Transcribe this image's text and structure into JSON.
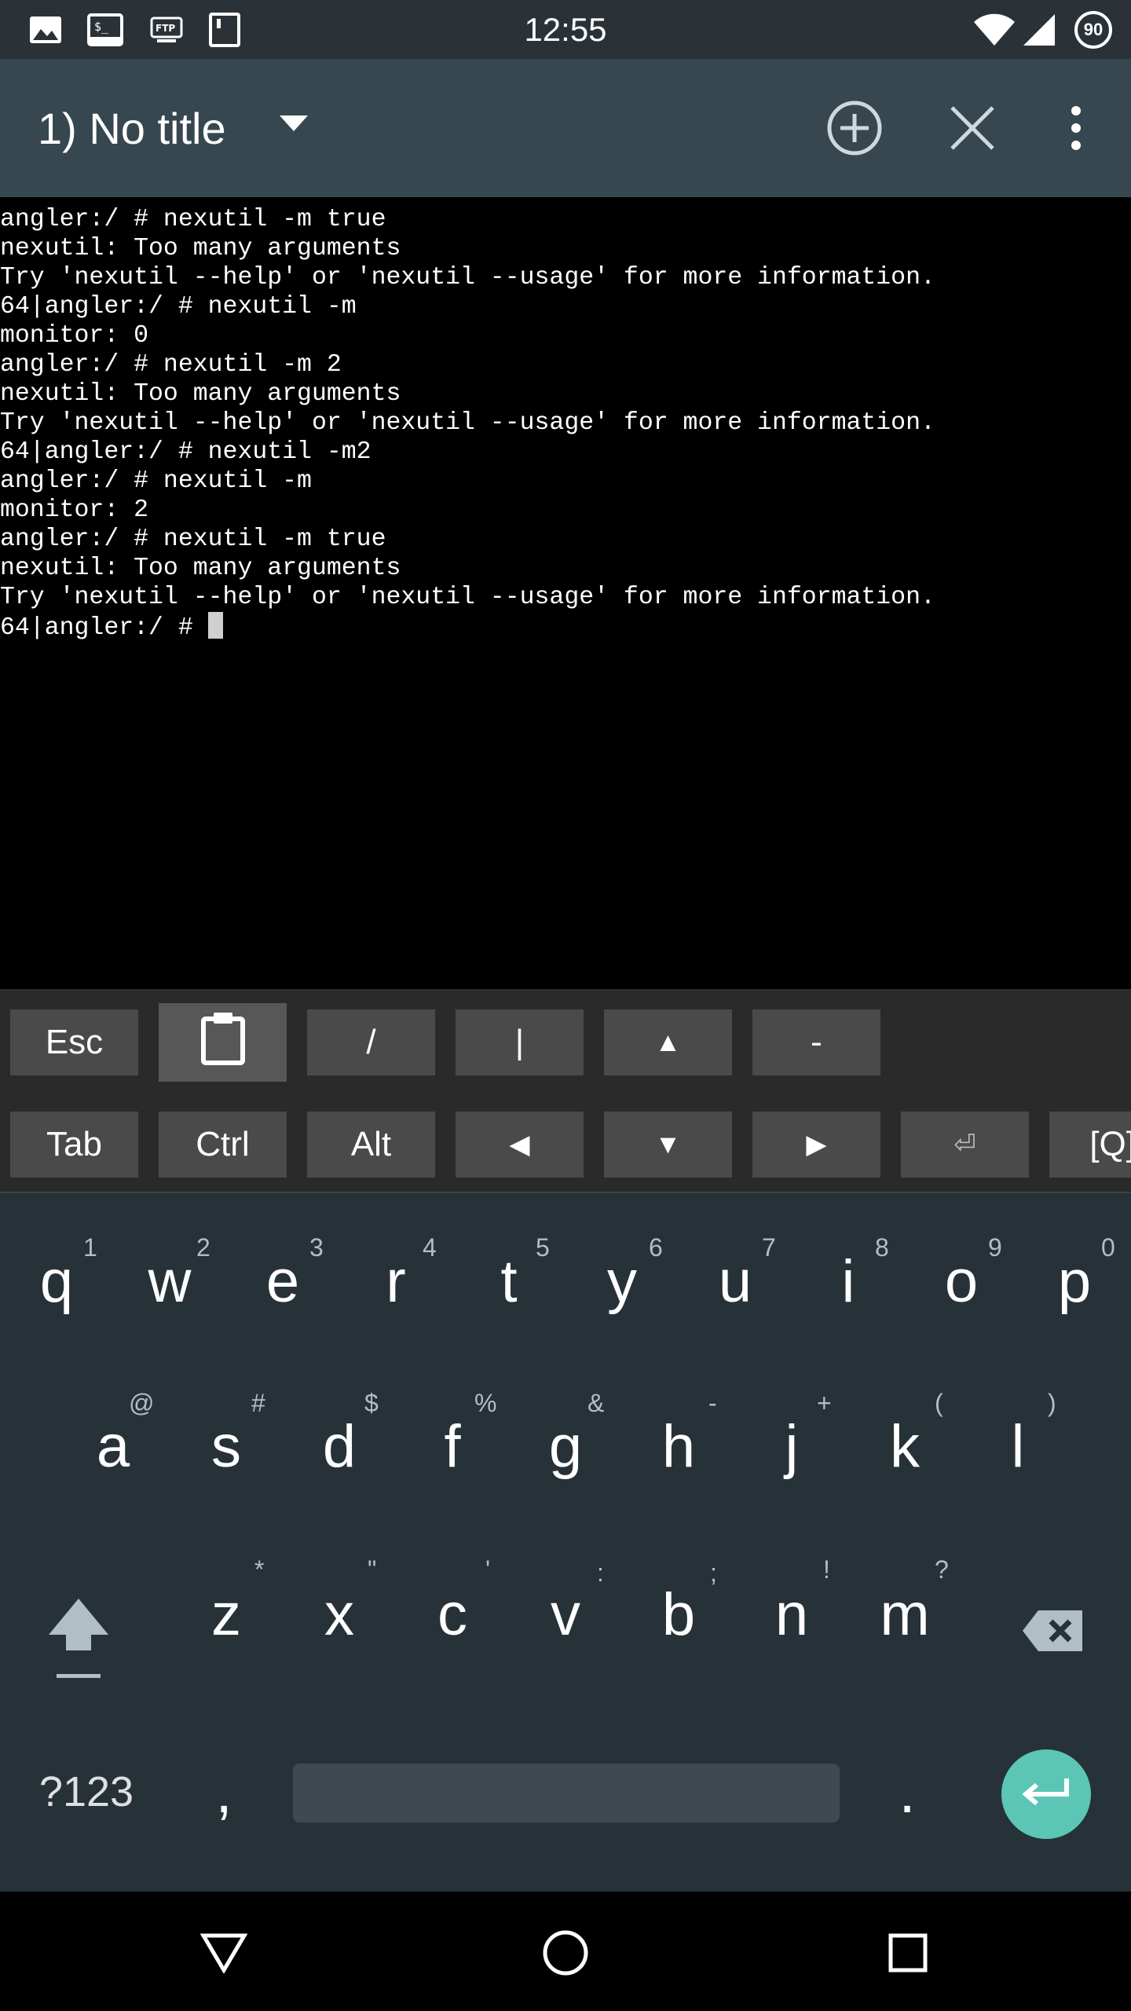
{
  "status_bar": {
    "time": "12:55",
    "battery_level": "90",
    "icons_left": [
      "image-icon",
      "terminal-icon",
      "ftp-icon",
      "sd-card-icon"
    ],
    "icons_right": [
      "wifi-icon",
      "signal-icon",
      "battery-icon"
    ]
  },
  "toolbar": {
    "title": "1) No title",
    "icons": [
      "dropdown-arrow-icon",
      "add-session-icon",
      "close-session-icon",
      "overflow-menu-icon"
    ]
  },
  "terminal": {
    "lines": [
      "angler:/ # nexutil -m true",
      "nexutil: Too many arguments",
      "Try 'nexutil --help' or 'nexutil --usage' for more information.",
      "64|angler:/ # nexutil -m",
      "monitor: 0",
      "angler:/ # nexutil -m 2",
      "nexutil: Too many arguments",
      "Try 'nexutil --help' or 'nexutil --usage' for more information.",
      "64|angler:/ # nexutil -m2",
      "angler:/ # nexutil -m",
      "monitor: 2",
      "angler:/ # nexutil -m true",
      "nexutil: Too many arguments",
      "Try 'nexutil --help' or 'nexutil --usage' for more information."
    ],
    "prompt": "64|angler:/ # "
  },
  "extra_keys": {
    "row1": [
      "Esc",
      "clipboard",
      "/",
      "|",
      "▲",
      "-"
    ],
    "row2": [
      "Tab",
      "Ctrl",
      "Alt",
      "◀",
      "▼",
      "▶",
      "⏎",
      "[Q]"
    ]
  },
  "keyboard": {
    "row1": [
      {
        "letter": "q",
        "hint": "1"
      },
      {
        "letter": "w",
        "hint": "2"
      },
      {
        "letter": "e",
        "hint": "3"
      },
      {
        "letter": "r",
        "hint": "4"
      },
      {
        "letter": "t",
        "hint": "5"
      },
      {
        "letter": "y",
        "hint": "6"
      },
      {
        "letter": "u",
        "hint": "7"
      },
      {
        "letter": "i",
        "hint": "8"
      },
      {
        "letter": "o",
        "hint": "9"
      },
      {
        "letter": "p",
        "hint": "0"
      }
    ],
    "row2": [
      {
        "letter": "a",
        "hint": "@"
      },
      {
        "letter": "s",
        "hint": "#"
      },
      {
        "letter": "d",
        "hint": "$"
      },
      {
        "letter": "f",
        "hint": "%"
      },
      {
        "letter": "g",
        "hint": "&"
      },
      {
        "letter": "h",
        "hint": "-"
      },
      {
        "letter": "j",
        "hint": "+"
      },
      {
        "letter": "k",
        "hint": "("
      },
      {
        "letter": "l",
        "hint": ")"
      }
    ],
    "row3": [
      {
        "letter": "z",
        "hint": "*"
      },
      {
        "letter": "x",
        "hint": "\""
      },
      {
        "letter": "c",
        "hint": "'"
      },
      {
        "letter": "v",
        "hint": ":"
      },
      {
        "letter": "b",
        "hint": ";"
      },
      {
        "letter": "n",
        "hint": "!"
      },
      {
        "letter": "m",
        "hint": "?"
      }
    ],
    "symbols_label": "?123",
    "comma": ",",
    "period": "."
  },
  "navbar": {
    "icons": [
      "back-icon",
      "home-icon",
      "recents-icon"
    ]
  }
}
